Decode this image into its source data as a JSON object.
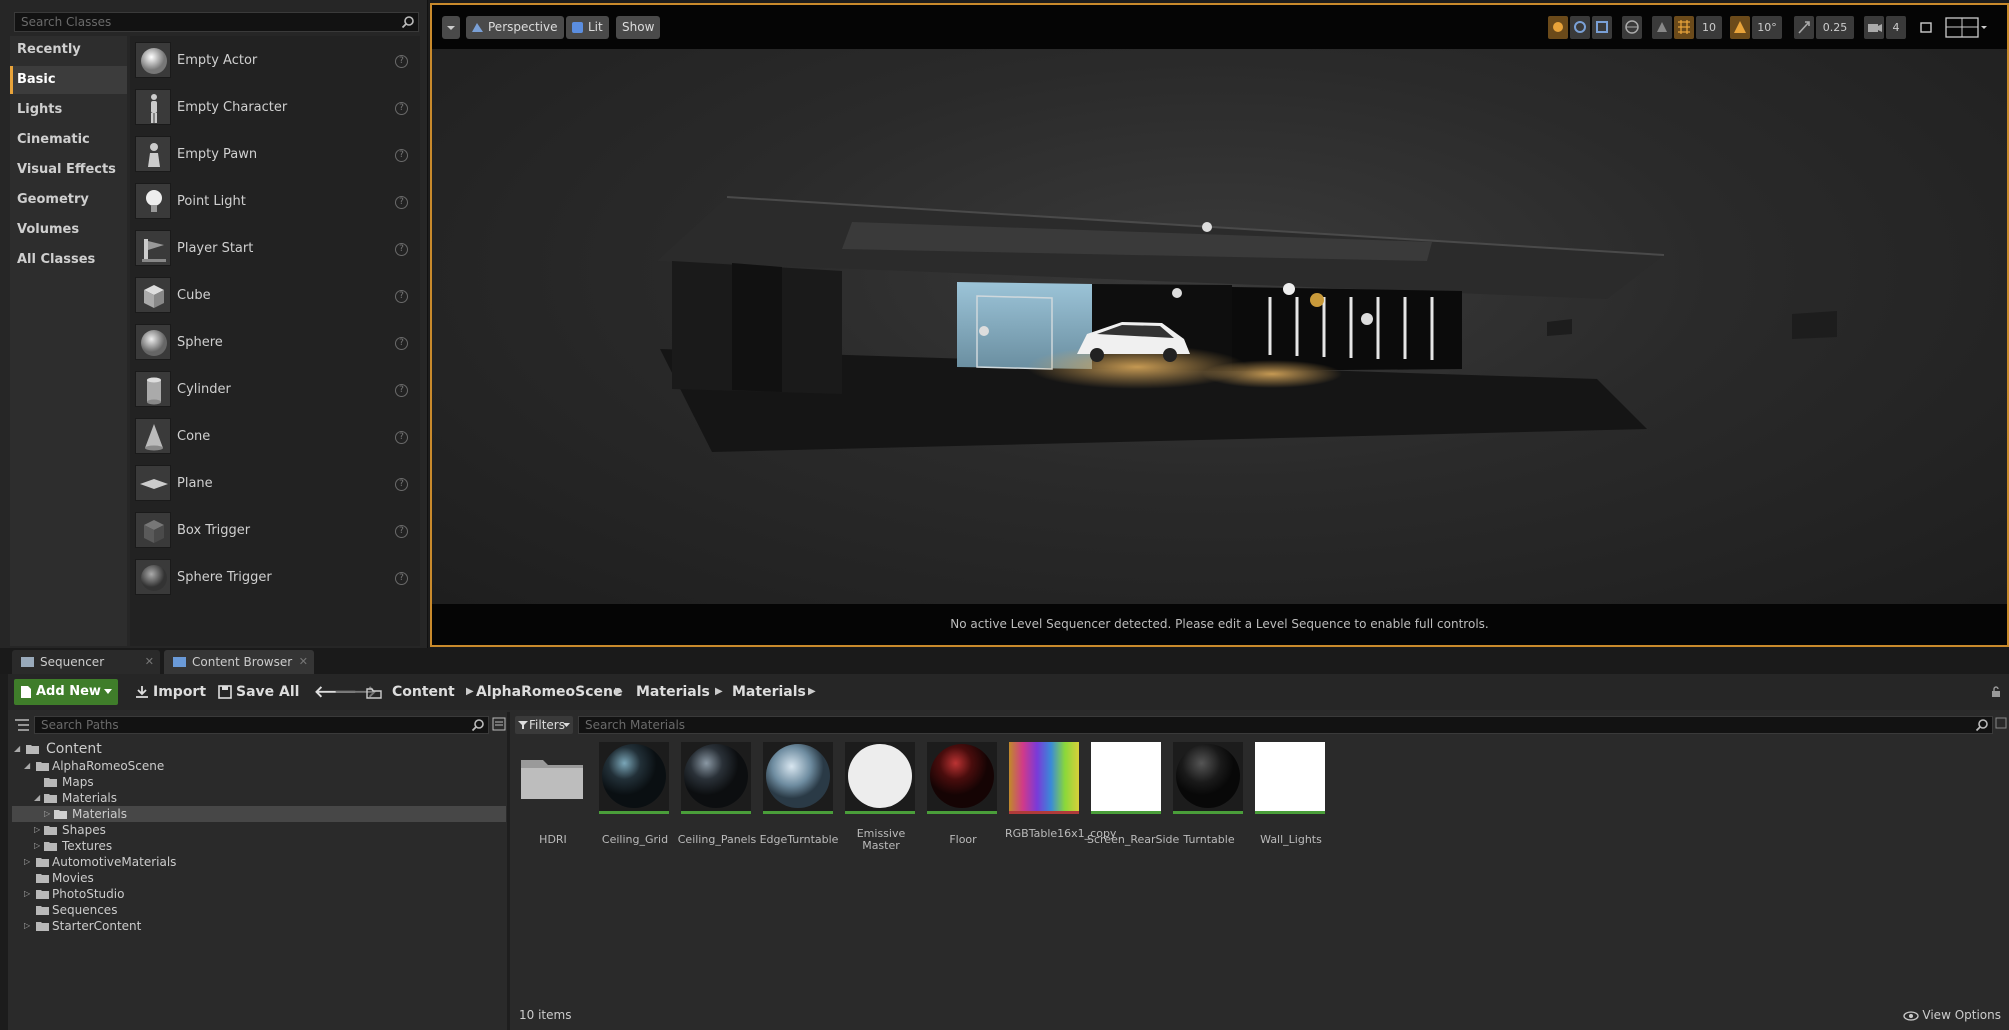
{
  "place_actors": {
    "search_placeholder": "Search Classes",
    "categories": [
      "Recently Placed",
      "Basic",
      "Lights",
      "Cinematic",
      "Visual Effects",
      "Geometry",
      "Volumes",
      "All Classes"
    ],
    "active_category": "Basic",
    "actors": [
      "Empty Actor",
      "Empty Character",
      "Empty Pawn",
      "Point Light",
      "Player Start",
      "Cube",
      "Sphere",
      "Cylinder",
      "Cone",
      "Plane",
      "Box Trigger",
      "Sphere Trigger"
    ],
    "help_glyph": "?"
  },
  "viewport": {
    "view_mode": "Perspective",
    "lighting": "Lit",
    "show": "Show",
    "grid_snap": "10",
    "rotation_snap": "10°",
    "scale_snap": "0.25",
    "camera_speed": "4",
    "status_message": "No active Level Sequencer detected. Please edit a Level Sequence to enable full controls."
  },
  "tabs": [
    {
      "label": "Sequencer",
      "active": false
    },
    {
      "label": "Content Browser",
      "active": true
    }
  ],
  "content_browser": {
    "add_new": "Add New",
    "import": "Import",
    "save_all": "Save All",
    "breadcrumbs": [
      "Content",
      "AlphaRomeoScene",
      "Materials",
      "Materials"
    ],
    "path_search_placeholder": "Search Paths",
    "tree": [
      {
        "label": "Content",
        "level": 0,
        "expanded": true
      },
      {
        "label": "AlphaRomeoScene",
        "level": 1,
        "expanded": true
      },
      {
        "label": "Maps",
        "level": 2,
        "expanded": false
      },
      {
        "label": "Materials",
        "level": 2,
        "expanded": true
      },
      {
        "label": "Materials",
        "level": 3,
        "expanded": false,
        "selected": true
      },
      {
        "label": "Shapes",
        "level": 2,
        "expanded": false
      },
      {
        "label": "Textures",
        "level": 2,
        "expanded": false
      },
      {
        "label": "AutomotiveMaterials",
        "level": 1,
        "expanded": false
      },
      {
        "label": "Movies",
        "level": 1,
        "expanded": false
      },
      {
        "label": "PhotoStudio",
        "level": 1,
        "expanded": false
      },
      {
        "label": "Sequences",
        "level": 1,
        "expanded": false
      },
      {
        "label": "StarterContent",
        "level": 1,
        "expanded": false
      }
    ],
    "filters": "Filters",
    "asset_search_placeholder": "Search Materials",
    "assets": [
      "HDRI",
      "Ceiling_Grid",
      "Ceiling_Panels",
      "EdgeTurntable",
      "Emissive Master",
      "Floor",
      "RGBTable16x1_copy",
      "Screen_RearSide",
      "Turntable",
      "Wall_Lights"
    ],
    "item_count": "10 items",
    "view_options": "View Options"
  },
  "colors": {
    "accent_orange": "#e8a33a",
    "add_new_green": "#3f7d2a",
    "material_underline": "#4a9e3a"
  }
}
